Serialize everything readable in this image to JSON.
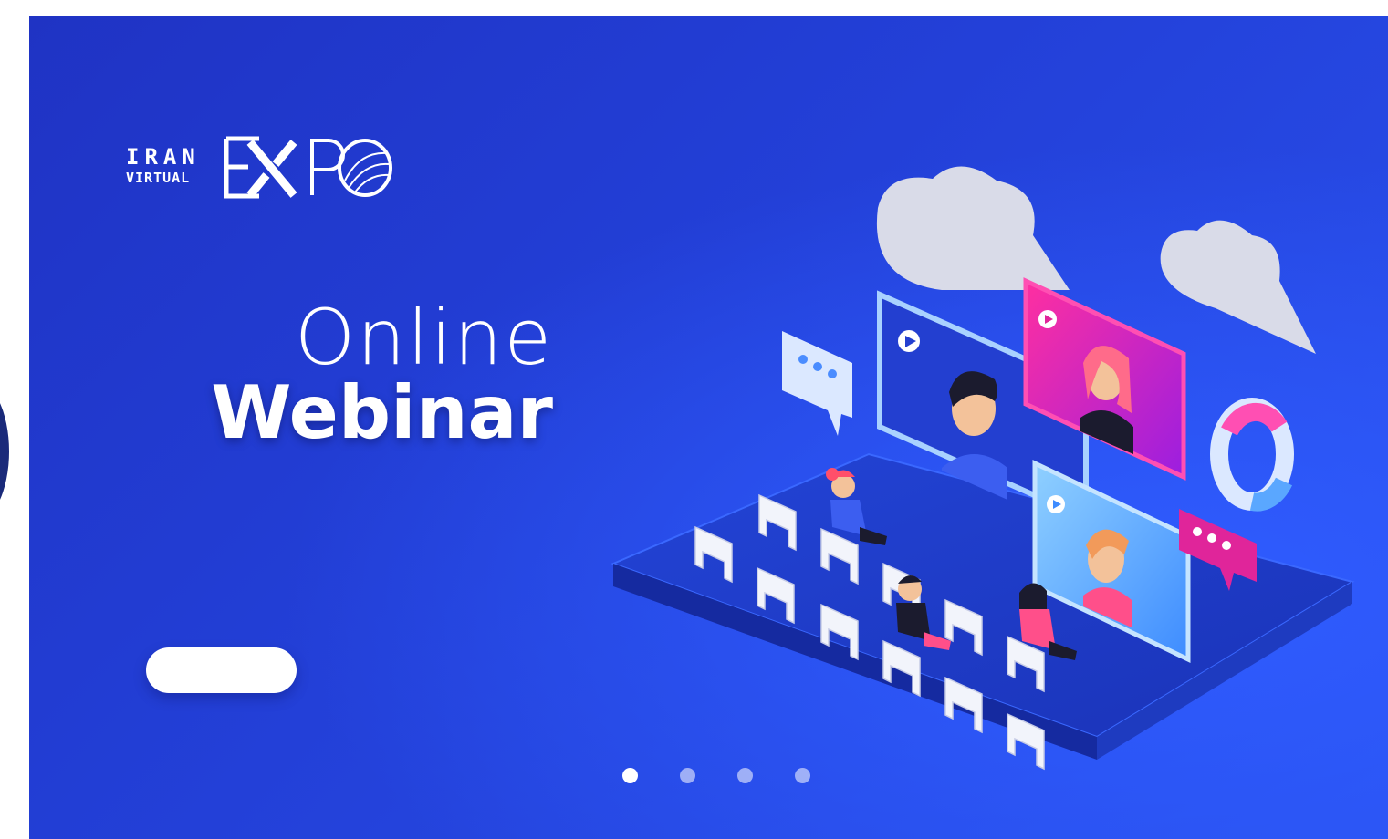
{
  "logo": {
    "line1": "IRAN",
    "line2": "VIRTUAL",
    "mark": "EXPO"
  },
  "hero": {
    "title_light": "Online",
    "title_bold": "Webinar",
    "cta_label": ""
  },
  "carousel": {
    "slide_count": 4,
    "active_index": 0
  },
  "illustration": {
    "icons": [
      "cloud-icon",
      "chat-bubble-icon",
      "video-screen-icon",
      "donut-chart-icon",
      "chair-icon",
      "person-icon",
      "play-icon"
    ]
  },
  "colors": {
    "banner_dark": "#1f33c4",
    "banner_light": "#2a52f0",
    "accent_pink": "#e0259a",
    "accent_light_blue": "#7fc3ff"
  }
}
